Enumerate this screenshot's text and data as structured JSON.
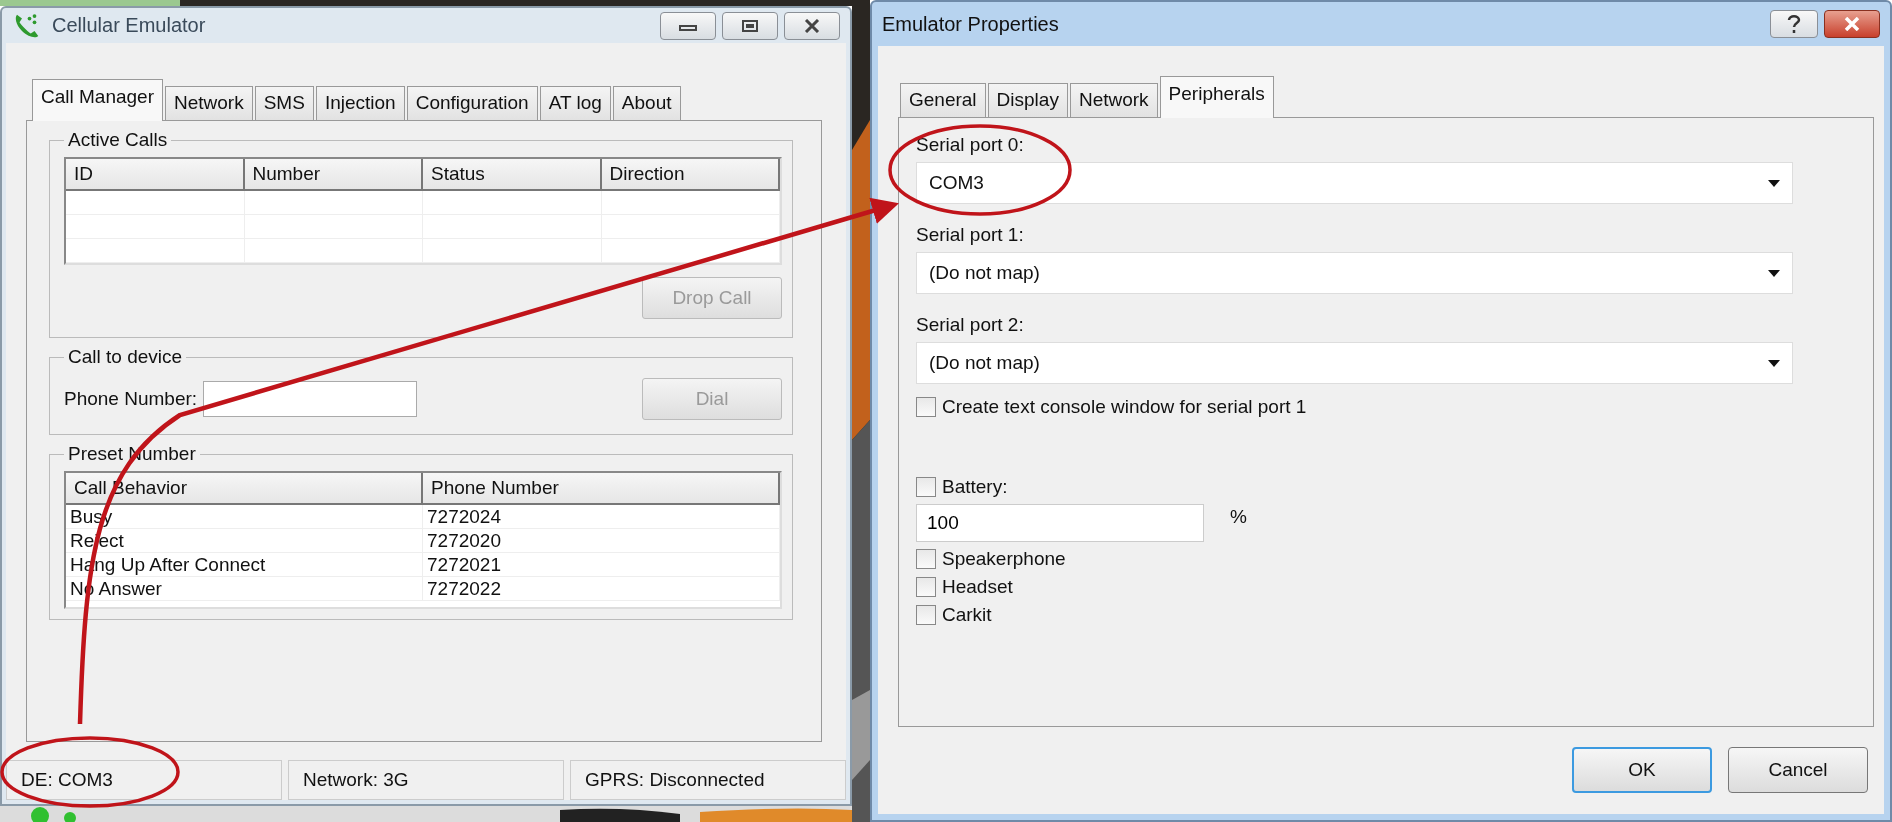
{
  "left_window": {
    "title": "Cellular Emulator",
    "tabs": [
      {
        "label": "Call Manager",
        "selected": true
      },
      {
        "label": "Network",
        "selected": false
      },
      {
        "label": "SMS",
        "selected": false
      },
      {
        "label": "Injection",
        "selected": false
      },
      {
        "label": "Configuration",
        "selected": false
      },
      {
        "label": "AT log",
        "selected": false
      },
      {
        "label": "About",
        "selected": false
      }
    ],
    "active_calls": {
      "legend": "Active Calls",
      "columns": [
        "ID",
        "Number",
        "Status",
        "Direction"
      ],
      "button": {
        "label": "Drop Call",
        "disabled": true
      }
    },
    "call_to_device": {
      "legend": "Call to device",
      "field_label": "Phone Number:",
      "button": {
        "label": "Dial",
        "disabled": true
      }
    },
    "preset_number": {
      "legend": "Preset Number",
      "columns": [
        "Call Behavior",
        "Phone Number"
      ],
      "rows": [
        [
          "Busy",
          "7272024"
        ],
        [
          "Reject",
          "7272020"
        ],
        [
          "Hang Up After Connect",
          "7272021"
        ],
        [
          "No Answer",
          "7272022"
        ]
      ]
    },
    "status_bar": [
      "DE: COM3",
      "Network: 3G",
      "GPRS: Disconnected"
    ]
  },
  "right_window": {
    "title": "Emulator Properties",
    "tabs": [
      {
        "label": "General",
        "selected": false
      },
      {
        "label": "Display",
        "selected": false
      },
      {
        "label": "Network",
        "selected": false
      },
      {
        "label": "Peripherals",
        "selected": true
      }
    ],
    "serial_ports": [
      {
        "label": "Serial port 0:",
        "value": "COM3"
      },
      {
        "label": "Serial port 1:",
        "value": "(Do not map)"
      },
      {
        "label": "Serial port 2:",
        "value": "(Do not map)"
      }
    ],
    "console_checkbox": {
      "label": "Create text console window for serial port 1",
      "checked": false
    },
    "battery": {
      "label": "Battery:",
      "checked": false,
      "value": "100",
      "unit": "%"
    },
    "options": [
      {
        "label": "Speakerphone",
        "checked": false
      },
      {
        "label": "Headset",
        "checked": false
      },
      {
        "label": "Carkit",
        "checked": false
      }
    ],
    "buttons": [
      {
        "label": "OK",
        "default": true
      },
      {
        "label": "Cancel",
        "default": false
      }
    ]
  }
}
